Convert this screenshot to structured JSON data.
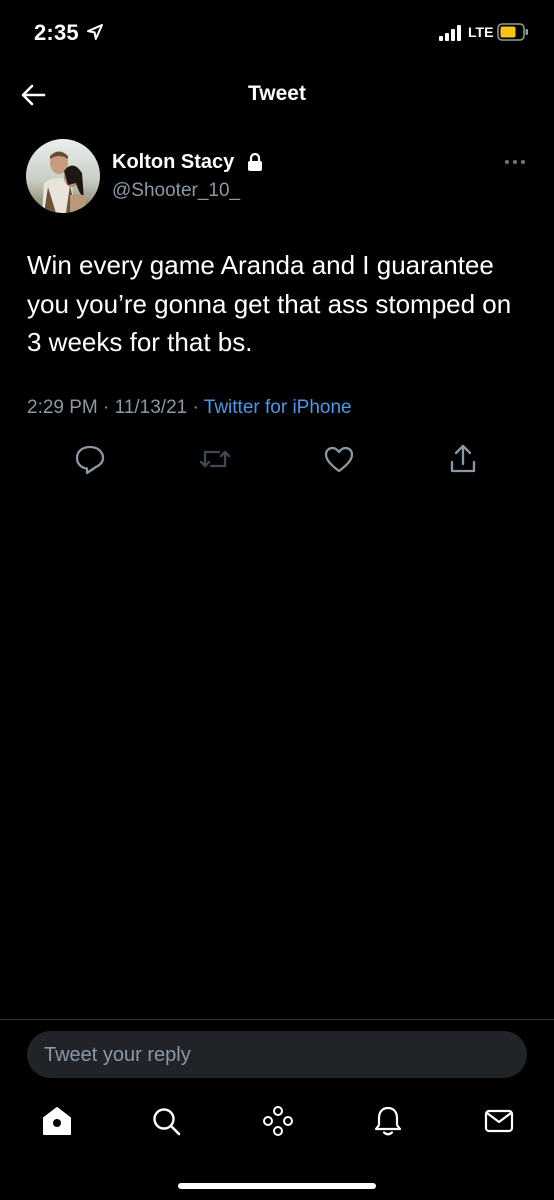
{
  "status_bar": {
    "time": "2:35",
    "network": "LTE",
    "battery_color": "#f5c518"
  },
  "nav": {
    "title": "Tweet",
    "back_icon": "arrow-left-icon"
  },
  "tweet": {
    "author": {
      "name": "Kolton Stacy",
      "handle": "@Shooter_10_",
      "protected_icon": "lock-icon"
    },
    "text": "Win every game Aranda and I guarantee you you’re gonna get that ass stomped on 3 weeks for that bs.",
    "time": "2:29 PM",
    "separator": " · ",
    "date": "11/13/21",
    "source": "Twitter for iPhone",
    "actions": [
      "reply-icon",
      "retweet-icon",
      "like-icon",
      "share-icon"
    ]
  },
  "reply": {
    "placeholder": "Tweet your reply"
  },
  "tab_bar": {
    "tabs": [
      "home-icon",
      "search-icon",
      "spaces-icon",
      "notifications-icon",
      "messages-icon"
    ]
  },
  "colors": {
    "background": "#000000",
    "text_primary": "#ffffff",
    "text_secondary": "#8b98a5",
    "link": "#4a99e9",
    "reply_field": "#202327",
    "retweet_disabled": "#3e4a54"
  }
}
